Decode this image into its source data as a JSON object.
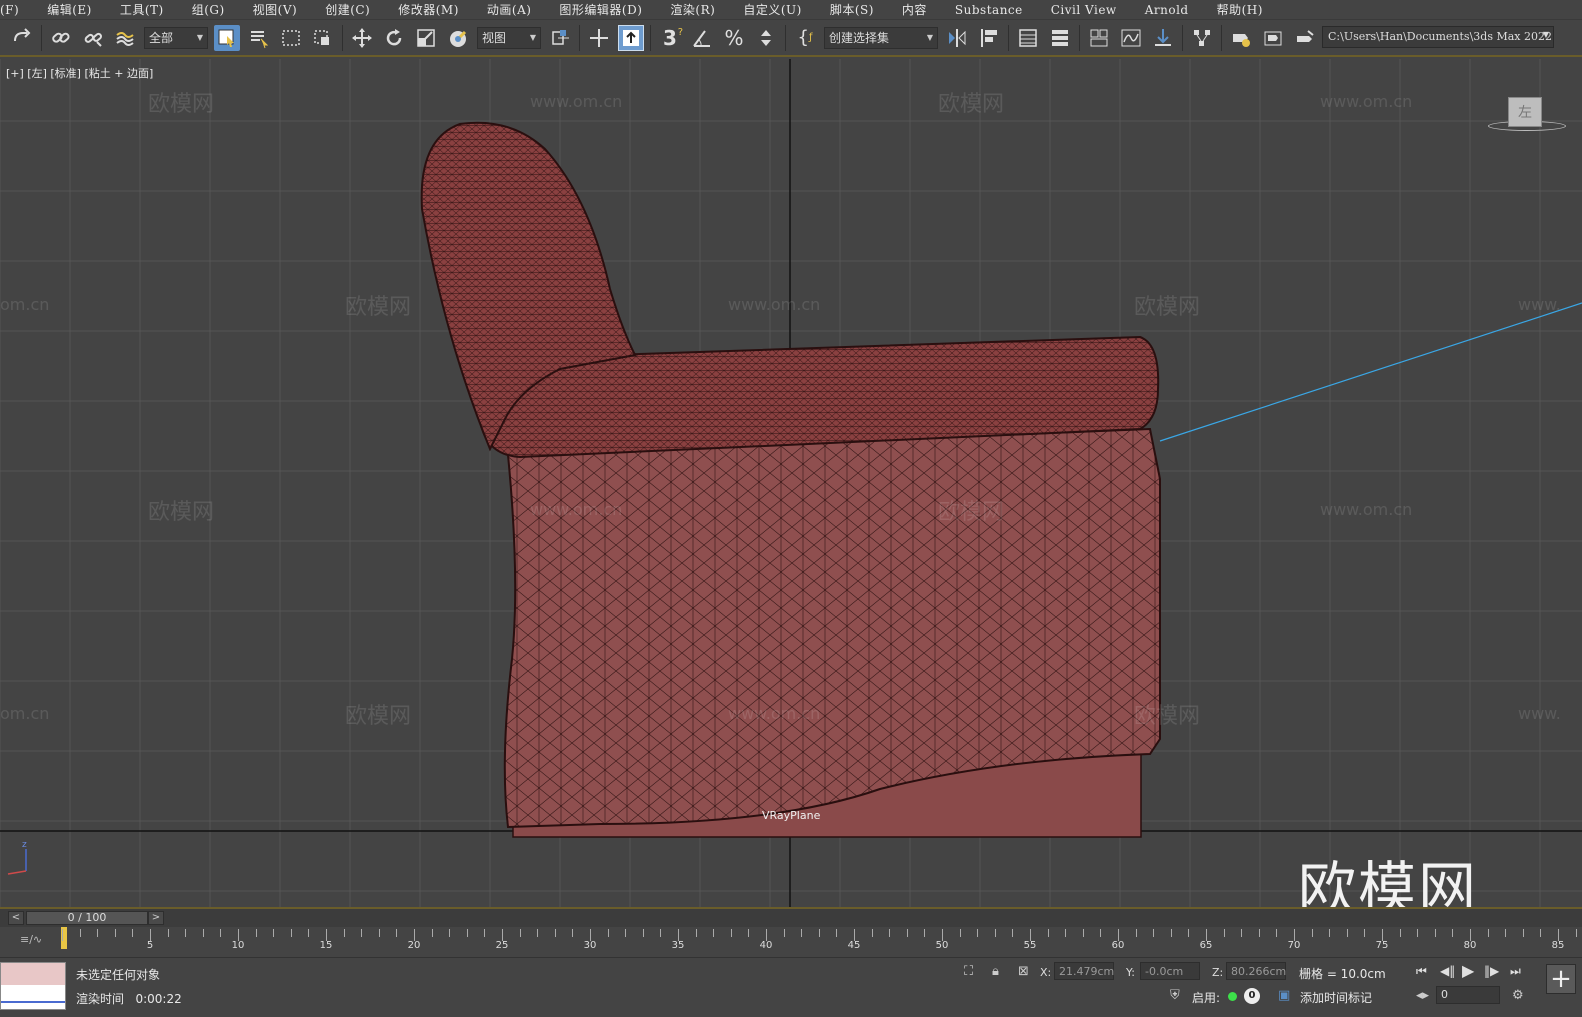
{
  "menu": [
    "(F)",
    "编辑(E)",
    "工具(T)",
    "组(G)",
    "视图(V)",
    "创建(C)",
    "修改器(M)",
    "动画(A)",
    "图形编辑器(D)",
    "渲染(R)",
    "自定义(U)",
    "脚本(S)",
    "内容",
    "Substance",
    "Civil View",
    "Arnold",
    "帮助(H)"
  ],
  "toolbar": {
    "filter_value": "全部",
    "refcoord_value": "视图",
    "named_selection_value": "创建选择集",
    "project_path": "C:\\Users\\Han\\Documents\\3ds Max 2022",
    "snap_label": "3"
  },
  "viewport": {
    "label": "[+] [左] [标准] [粘土 + 边面]",
    "object_label": "VRayPlane",
    "viewcube_face": "左",
    "watermark_text": "欧模网",
    "watermark_url": "www.om.cn",
    "watermark_url_partial": "om.cn",
    "watermark_url_partial2": "www.",
    "brand_logo": "欧模网",
    "model_color": "#8a4a4a",
    "wire_color": "#2a0f0f"
  },
  "timeslider": {
    "value": "0 / 100",
    "prev": "<",
    "next": ">"
  },
  "trackbar": {
    "labels": [
      "5",
      "10",
      "15",
      "20",
      "25",
      "30",
      "35",
      "40",
      "45",
      "50",
      "55",
      "60",
      "65",
      "70",
      "75",
      "80",
      "85"
    ],
    "current_frame": 0,
    "total_frames": 100
  },
  "status": {
    "message": "未选定任何对象",
    "render_time_label": "渲染时间",
    "render_time_value": "0:00:22",
    "x_label": "X:",
    "x_value": "21.479cm",
    "y_label": "Y:",
    "y_value": "-0.0cm",
    "z_label": "Z:",
    "z_value": "80.266cm",
    "grid_text": "栅格 = 10.0cm",
    "enable_label": "启用:",
    "enable_count": "0",
    "add_time_tag": "添加时间标记",
    "frame_input": "0"
  }
}
